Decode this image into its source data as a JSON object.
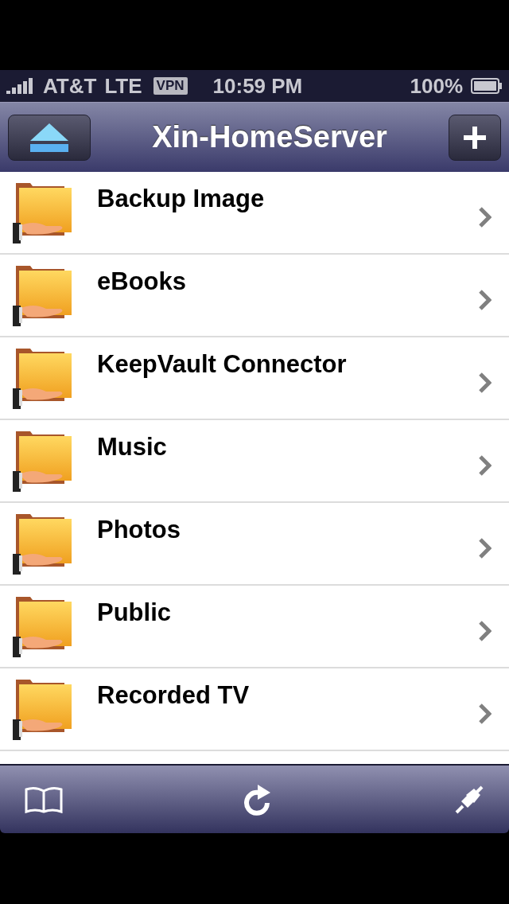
{
  "status_bar": {
    "carrier": "AT&T",
    "network": "LTE",
    "vpn": "VPN",
    "time": "10:59 PM",
    "battery": "100%"
  },
  "nav_bar": {
    "title": "Xin-HomeServer"
  },
  "folders": [
    {
      "name": "Backup Image"
    },
    {
      "name": "eBooks"
    },
    {
      "name": "KeepVault Connector"
    },
    {
      "name": "Music"
    },
    {
      "name": "Photos"
    },
    {
      "name": "Public"
    },
    {
      "name": "Recorded TV"
    }
  ]
}
